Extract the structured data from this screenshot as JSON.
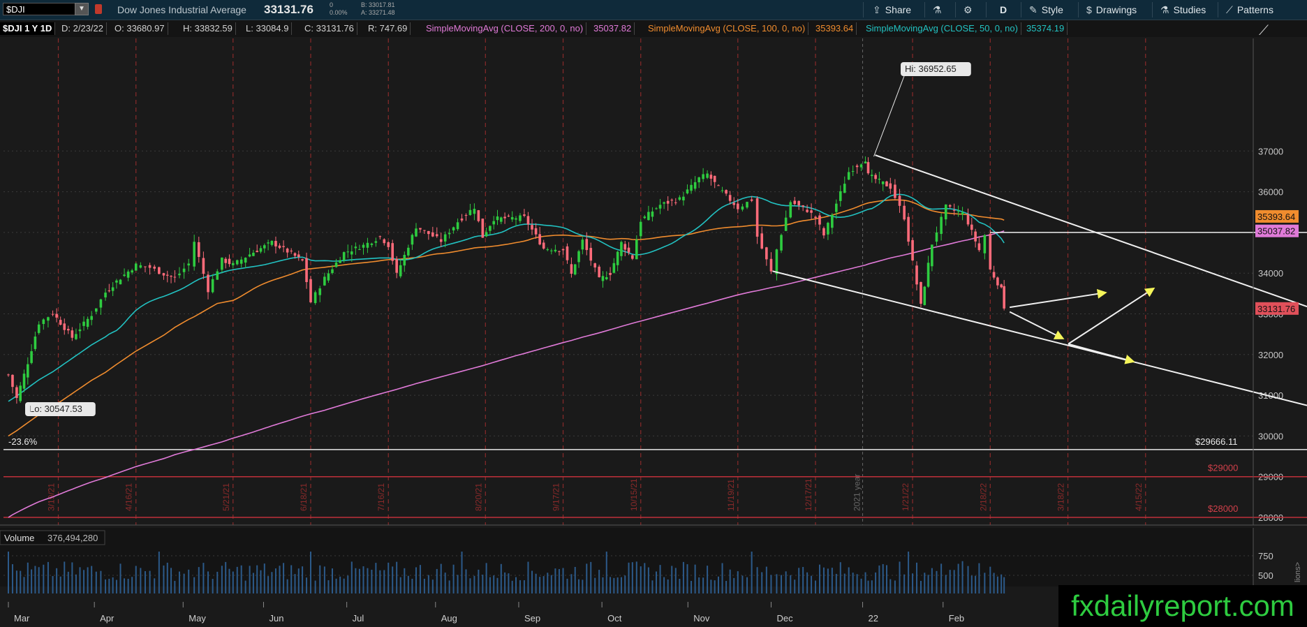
{
  "topbar": {
    "symbol": "$DJI",
    "name": "Dow Jones Industrial Average",
    "last": "33131.76",
    "change": "0",
    "change_pct": "0.00%",
    "bid": "B: 33017.81",
    "ask": "A: 33271.48",
    "share_label": "Share",
    "period_label": "D",
    "style_label": "Style",
    "drawings_label": "Drawings",
    "studies_label": "Studies",
    "patterns_label": "Patterns"
  },
  "infobar": {
    "symbol_period": "$DJI 1 Y 1D",
    "date": "D: 2/23/22",
    "open": "O: 33680.97",
    "high": "H: 33832.59",
    "low": "L: 33084.9",
    "close": "C: 33131.76",
    "range": "R: 747.69",
    "sma200_label": "SimpleMovingAvg (CLOSE, 200, 0, no)",
    "sma200_value": "35037.82",
    "sma100_label": "SimpleMovingAvg (CLOSE, 100, 0, no)",
    "sma100_value": "35393.64",
    "sma50_label": "SimpleMovingAvg (CLOSE, 50, 0, no)",
    "sma50_value": "35374.19"
  },
  "colors": {
    "up": "#2ecc40",
    "down": "#ff6b7a",
    "sma200": "#e07ad8",
    "sma100": "#f08c2e",
    "sma50": "#22c2c2",
    "red_level": "#c0303a"
  },
  "chart_data": {
    "type": "candlestick",
    "timeframe": "1 Y 1D",
    "ylim": [
      27800,
      37800
    ],
    "y_ticks": [
      28000,
      29000,
      30000,
      31000,
      32000,
      33000,
      34000,
      35000,
      36000,
      37000
    ],
    "x_month_labels": [
      "Mar",
      "Apr",
      "May",
      "Jun",
      "Jul",
      "Aug",
      "Sep",
      "Oct",
      "Nov",
      "Dec",
      "22",
      "Feb"
    ],
    "vertical_date_labels": [
      "3/19/21",
      "4/16/21",
      "5/21/21",
      "6/18/21",
      "7/16/21",
      "8/20/21",
      "9/17/21",
      "10/15/21",
      "11/19/21",
      "12/17/21",
      "1/21/22",
      "2/18/22",
      "3/18/22",
      "4/15/22"
    ],
    "year_marker": "2021 year",
    "price_path": [
      [
        "3/1/21",
        31500
      ],
      [
        "3/4/21",
        30924
      ],
      [
        "3/8/21",
        31802
      ],
      [
        "3/12/21",
        32778
      ],
      [
        "3/17/21",
        33015
      ],
      [
        "3/24/21",
        32420
      ],
      [
        "3/31/21",
        32981
      ],
      [
        "4/5/21",
        33527
      ],
      [
        "4/9/21",
        33800
      ],
      [
        "4/16/21",
        34200
      ],
      [
        "4/21/21",
        34137
      ],
      [
        "4/26/21",
        33980
      ],
      [
        "4/30/21",
        33874
      ],
      [
        "5/5/21",
        34230
      ],
      [
        "5/7/21",
        34777
      ],
      [
        "5/12/21",
        33587
      ],
      [
        "5/17/21",
        34327
      ],
      [
        "5/21/21",
        34207
      ],
      [
        "5/27/21",
        34464
      ],
      [
        "6/4/21",
        34756
      ],
      [
        "6/11/21",
        34479
      ],
      [
        "6/15/21",
        34300
      ],
      [
        "6/18/21",
        33290
      ],
      [
        "6/23/21",
        33874
      ],
      [
        "6/30/21",
        34502
      ],
      [
        "7/7/21",
        34681
      ],
      [
        "7/13/21",
        34888
      ],
      [
        "7/16/21",
        34687
      ],
      [
        "7/19/21",
        33962
      ],
      [
        "7/26/21",
        35144
      ],
      [
        "8/4/21",
        34792
      ],
      [
        "8/10/21",
        35264
      ],
      [
        "8/16/21",
        35625
      ],
      [
        "8/19/21",
        34894
      ],
      [
        "8/23/21",
        35335
      ],
      [
        "8/31/21",
        35360
      ],
      [
        "9/3/21",
        35369
      ],
      [
        "9/10/21",
        34607
      ],
      [
        "9/17/21",
        34584
      ],
      [
        "9/20/21",
        33970
      ],
      [
        "9/24/21",
        34798
      ],
      [
        "9/30/21",
        33843
      ],
      [
        "10/4/21",
        34002
      ],
      [
        "10/8/21",
        34746
      ],
      [
        "10/12/21",
        34378
      ],
      [
        "10/15/21",
        35294
      ],
      [
        "10/22/21",
        35677
      ],
      [
        "10/29/21",
        35820
      ],
      [
        "11/5/21",
        36328
      ],
      [
        "11/8/21",
        36432
      ],
      [
        "11/12/21",
        36100
      ],
      [
        "11/19/21",
        35602
      ],
      [
        "11/24/21",
        35804
      ],
      [
        "11/26/21",
        34899
      ],
      [
        "12/1/21",
        34022
      ],
      [
        "12/3/21",
        34580
      ],
      [
        "12/8/21",
        35754
      ],
      [
        "12/14/21",
        35544
      ],
      [
        "12/17/21",
        35365
      ],
      [
        "12/20/21",
        34932
      ],
      [
        "12/29/21",
        36488
      ],
      [
        "1/4/22",
        36800
      ],
      [
        "1/5/22",
        36407
      ],
      [
        "1/13/22",
        36113
      ],
      [
        "1/18/22",
        35368
      ],
      [
        "1/21/22",
        34265
      ],
      [
        "1/24/22",
        33200
      ],
      [
        "1/28/22",
        34725
      ],
      [
        "2/2/22",
        35629
      ],
      [
        "2/8/22",
        35462
      ],
      [
        "2/10/22",
        35241
      ],
      [
        "2/14/22",
        34566
      ],
      [
        "2/16/22",
        34934
      ],
      [
        "2/18/22",
        34079
      ],
      [
        "2/22/22",
        33597
      ],
      [
        "2/23/22",
        33131.76
      ]
    ],
    "annotations": {
      "high": {
        "label": "Hi: 36952.65",
        "value": 36952.65
      },
      "low": {
        "label": "Lo: 30547.53",
        "value": 30547.53
      },
      "fib_label": "-23.6%",
      "fib_value_label": "$29666.11",
      "fib_value": 29666.11,
      "red_level_1": {
        "label": "$29000",
        "value": 29000
      },
      "red_level_2": {
        "label": "$28000",
        "value": 28000
      }
    },
    "price_tags": [
      {
        "label": "35393.64",
        "value": 35393.64,
        "series": "sma100"
      },
      {
        "label": "35037.82",
        "value": 35037.82,
        "series": "sma200"
      },
      {
        "label": "33131.76",
        "value": 33131.76,
        "series": "price"
      }
    ],
    "volume": {
      "label": "Volume",
      "value": "376,494,280",
      "ticks": [
        "750",
        "500"
      ],
      "unit_label": "lions>"
    },
    "grid": true
  },
  "brand": "fxdailyreport.com"
}
